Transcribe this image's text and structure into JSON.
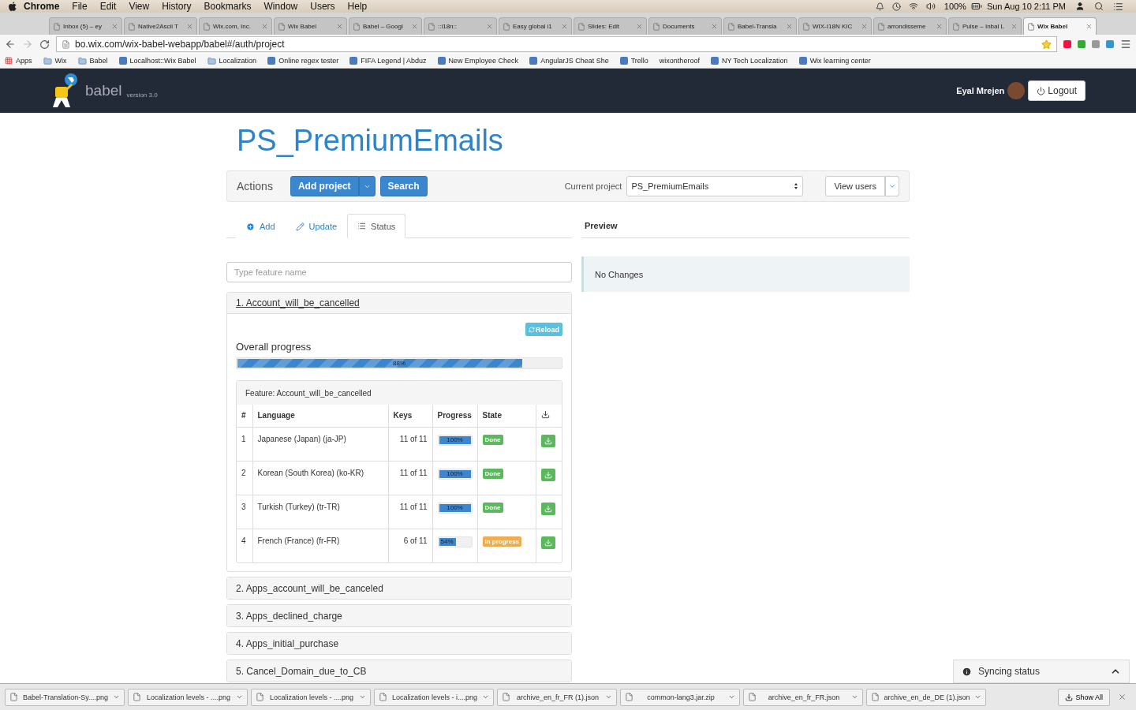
{
  "menubar": {
    "menus": [
      "Chrome",
      "File",
      "Edit",
      "View",
      "History",
      "Bookmarks",
      "Window",
      "Users",
      "Help"
    ],
    "battery": "100%",
    "clock": "Sun Aug 10  2:11 PM"
  },
  "chrome": {
    "tabs": [
      {
        "title": "Inbox (5) – ey",
        "selected": false
      },
      {
        "title": "Native2Ascii T",
        "selected": false
      },
      {
        "title": "Wix.com, Inc.",
        "selected": false
      },
      {
        "title": "Wix Babel",
        "selected": false
      },
      {
        "title": "Babel – Googl",
        "selected": false
      },
      {
        "title": "::i18n::",
        "selected": false
      },
      {
        "title": "Easy global i1",
        "selected": false
      },
      {
        "title": "Slides: Edit",
        "selected": false
      },
      {
        "title": "Documents",
        "selected": false
      },
      {
        "title": "Babel-Transla",
        "selected": false
      },
      {
        "title": "WIX-I18N KIC",
        "selected": false
      },
      {
        "title": "arrondisseme",
        "selected": false
      },
      {
        "title": "Pulse – Inbal L",
        "selected": false
      },
      {
        "title": "Wix Babel",
        "selected": true
      }
    ],
    "address": "bo.wix.com/wix-babel-webapp/babel#/auth/project",
    "bookmarks": [
      {
        "label": "Apps",
        "kind": "apps"
      },
      {
        "label": "Wix",
        "kind": "folder"
      },
      {
        "label": "Babel",
        "kind": "folder"
      },
      {
        "label": "Localhost::Wix Babel",
        "kind": "page"
      },
      {
        "label": "Localization",
        "kind": "folder"
      },
      {
        "label": "Online regex tester",
        "kind": "page"
      },
      {
        "label": "FIFA Legend | Abduz",
        "kind": "page"
      },
      {
        "label": "New Employee Check",
        "kind": "page"
      },
      {
        "label": "AngularJS Cheat She",
        "kind": "page"
      },
      {
        "label": "Trello",
        "kind": "page"
      },
      {
        "label": "wixontheroof",
        "kind": "plain"
      },
      {
        "label": "NY Tech Localization",
        "kind": "page"
      },
      {
        "label": "Wix learning center",
        "kind": "page"
      }
    ]
  },
  "app_header": {
    "brand": "babel",
    "version": "version 3.0",
    "user": "Eyal Mrejen",
    "logout": "Logout"
  },
  "project_title": "PS_PremiumEmails",
  "actions": {
    "label": "Actions",
    "add_project": "Add project",
    "search": "Search",
    "current_project_label": "Current project",
    "current_project": "PS_PremiumEmails",
    "view_users": "View users"
  },
  "tabs": [
    {
      "label": "Add",
      "selected": false
    },
    {
      "label": "Update",
      "selected": false
    },
    {
      "label": "Status",
      "selected": true
    }
  ],
  "preview": {
    "title": "Preview",
    "message": "No Changes"
  },
  "search": {
    "placeholder": "Type feature name"
  },
  "features": [
    {
      "title": "1. Account_will_be_cancelled",
      "expanded": true,
      "detail": {
        "reload": "Reload",
        "overall_label": "Overall progress",
        "overall": {
          "level": 0.88,
          "reading": "88%"
        },
        "heading": "Feature: Account_will_be_cancelled",
        "columns": [
          "#",
          "Language",
          "Keys",
          "Progress",
          "State"
        ],
        "rows": [
          {
            "num": "1",
            "language": "Japanese (Japan) (ja-JP)",
            "keys": "11 of 11",
            "level": 1,
            "reading": "100%",
            "state": "Done",
            "kind": "done"
          },
          {
            "num": "2",
            "language": "Korean (South Korea) (ko-KR)",
            "keys": "11 of 11",
            "level": 1,
            "reading": "100%",
            "state": "Done",
            "kind": "done"
          },
          {
            "num": "3",
            "language": "Turkish (Turkey) (tr-TR)",
            "keys": "11 of 11",
            "level": 1,
            "reading": "100%",
            "state": "Done",
            "kind": "done"
          },
          {
            "num": "4",
            "language": "French (France) (fr-FR)",
            "keys": "6 of 11",
            "level": 0.54,
            "reading": "54%",
            "state": "In progress",
            "kind": "progress"
          }
        ]
      }
    },
    {
      "title": "2. Apps_account_will_be_canceled",
      "expanded": false
    },
    {
      "title": "3. Apps_declined_charge",
      "expanded": false
    },
    {
      "title": "4. Apps_initial_purchase",
      "expanded": false
    },
    {
      "title": "5. Cancel_Domain_due_to_CB",
      "expanded": false
    }
  ],
  "syncing": {
    "label": "Syncing status"
  },
  "downloads": {
    "files": [
      "Babel-Translation-Sy....png",
      "Localization levels - ....png",
      "Localization levels - ....png",
      "Localization levels - i....png",
      "archive_en_fr_FR (1).json",
      "common-lang3.jar.zip",
      "archive_en_fr_FR.json",
      "archive_en_de_DE (1).json"
    ],
    "show_all": "Show All"
  }
}
